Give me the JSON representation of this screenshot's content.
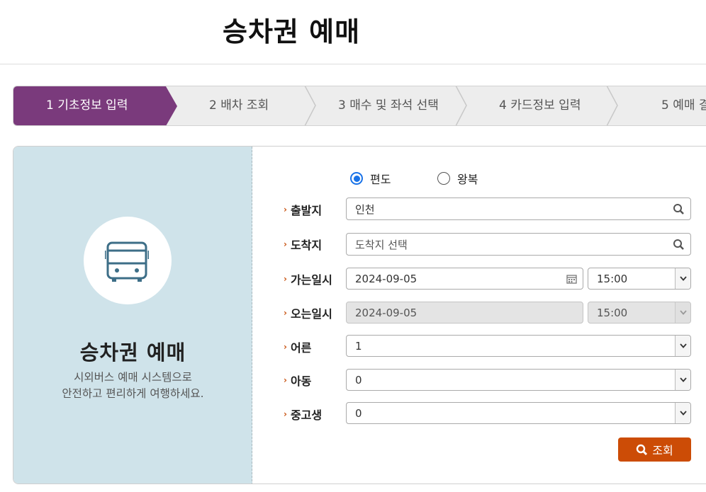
{
  "page": {
    "title": "승차권 예매"
  },
  "steps": [
    {
      "label": "1 기초정보 입력",
      "active": true
    },
    {
      "label": "2 배차 조회",
      "active": false
    },
    {
      "label": "3 매수 및 좌석 선택",
      "active": false
    },
    {
      "label": "4 카드정보 입력",
      "active": false
    },
    {
      "label": "5 예매 결",
      "active": false
    }
  ],
  "intro": {
    "title": "승차권 예매",
    "desc_line1": "시외버스 예매 시스템으로",
    "desc_line2": "안전하고 편리하게 여행하세요."
  },
  "trip_type": {
    "one_way": "편도",
    "round_trip": "왕복",
    "selected": "one_way"
  },
  "form": {
    "departure": {
      "label": "출발지",
      "value": "인천"
    },
    "arrival": {
      "label": "도착지",
      "placeholder": "도착지 선택"
    },
    "depart_datetime": {
      "label": "가는일시",
      "date": "2024-09-05",
      "time": "15:00"
    },
    "return_datetime": {
      "label": "오는일시",
      "date": "2024-09-05",
      "time": "15:00"
    },
    "adult": {
      "label": "어른",
      "value": "1"
    },
    "child": {
      "label": "아동",
      "value": "0"
    },
    "student": {
      "label": "중고생",
      "value": "0"
    },
    "search_label": "조회"
  },
  "colors": {
    "accent": "#7a3a7c",
    "button": "#cc4c06",
    "panel": "#cfe3ea",
    "bullet": "#c85210"
  }
}
